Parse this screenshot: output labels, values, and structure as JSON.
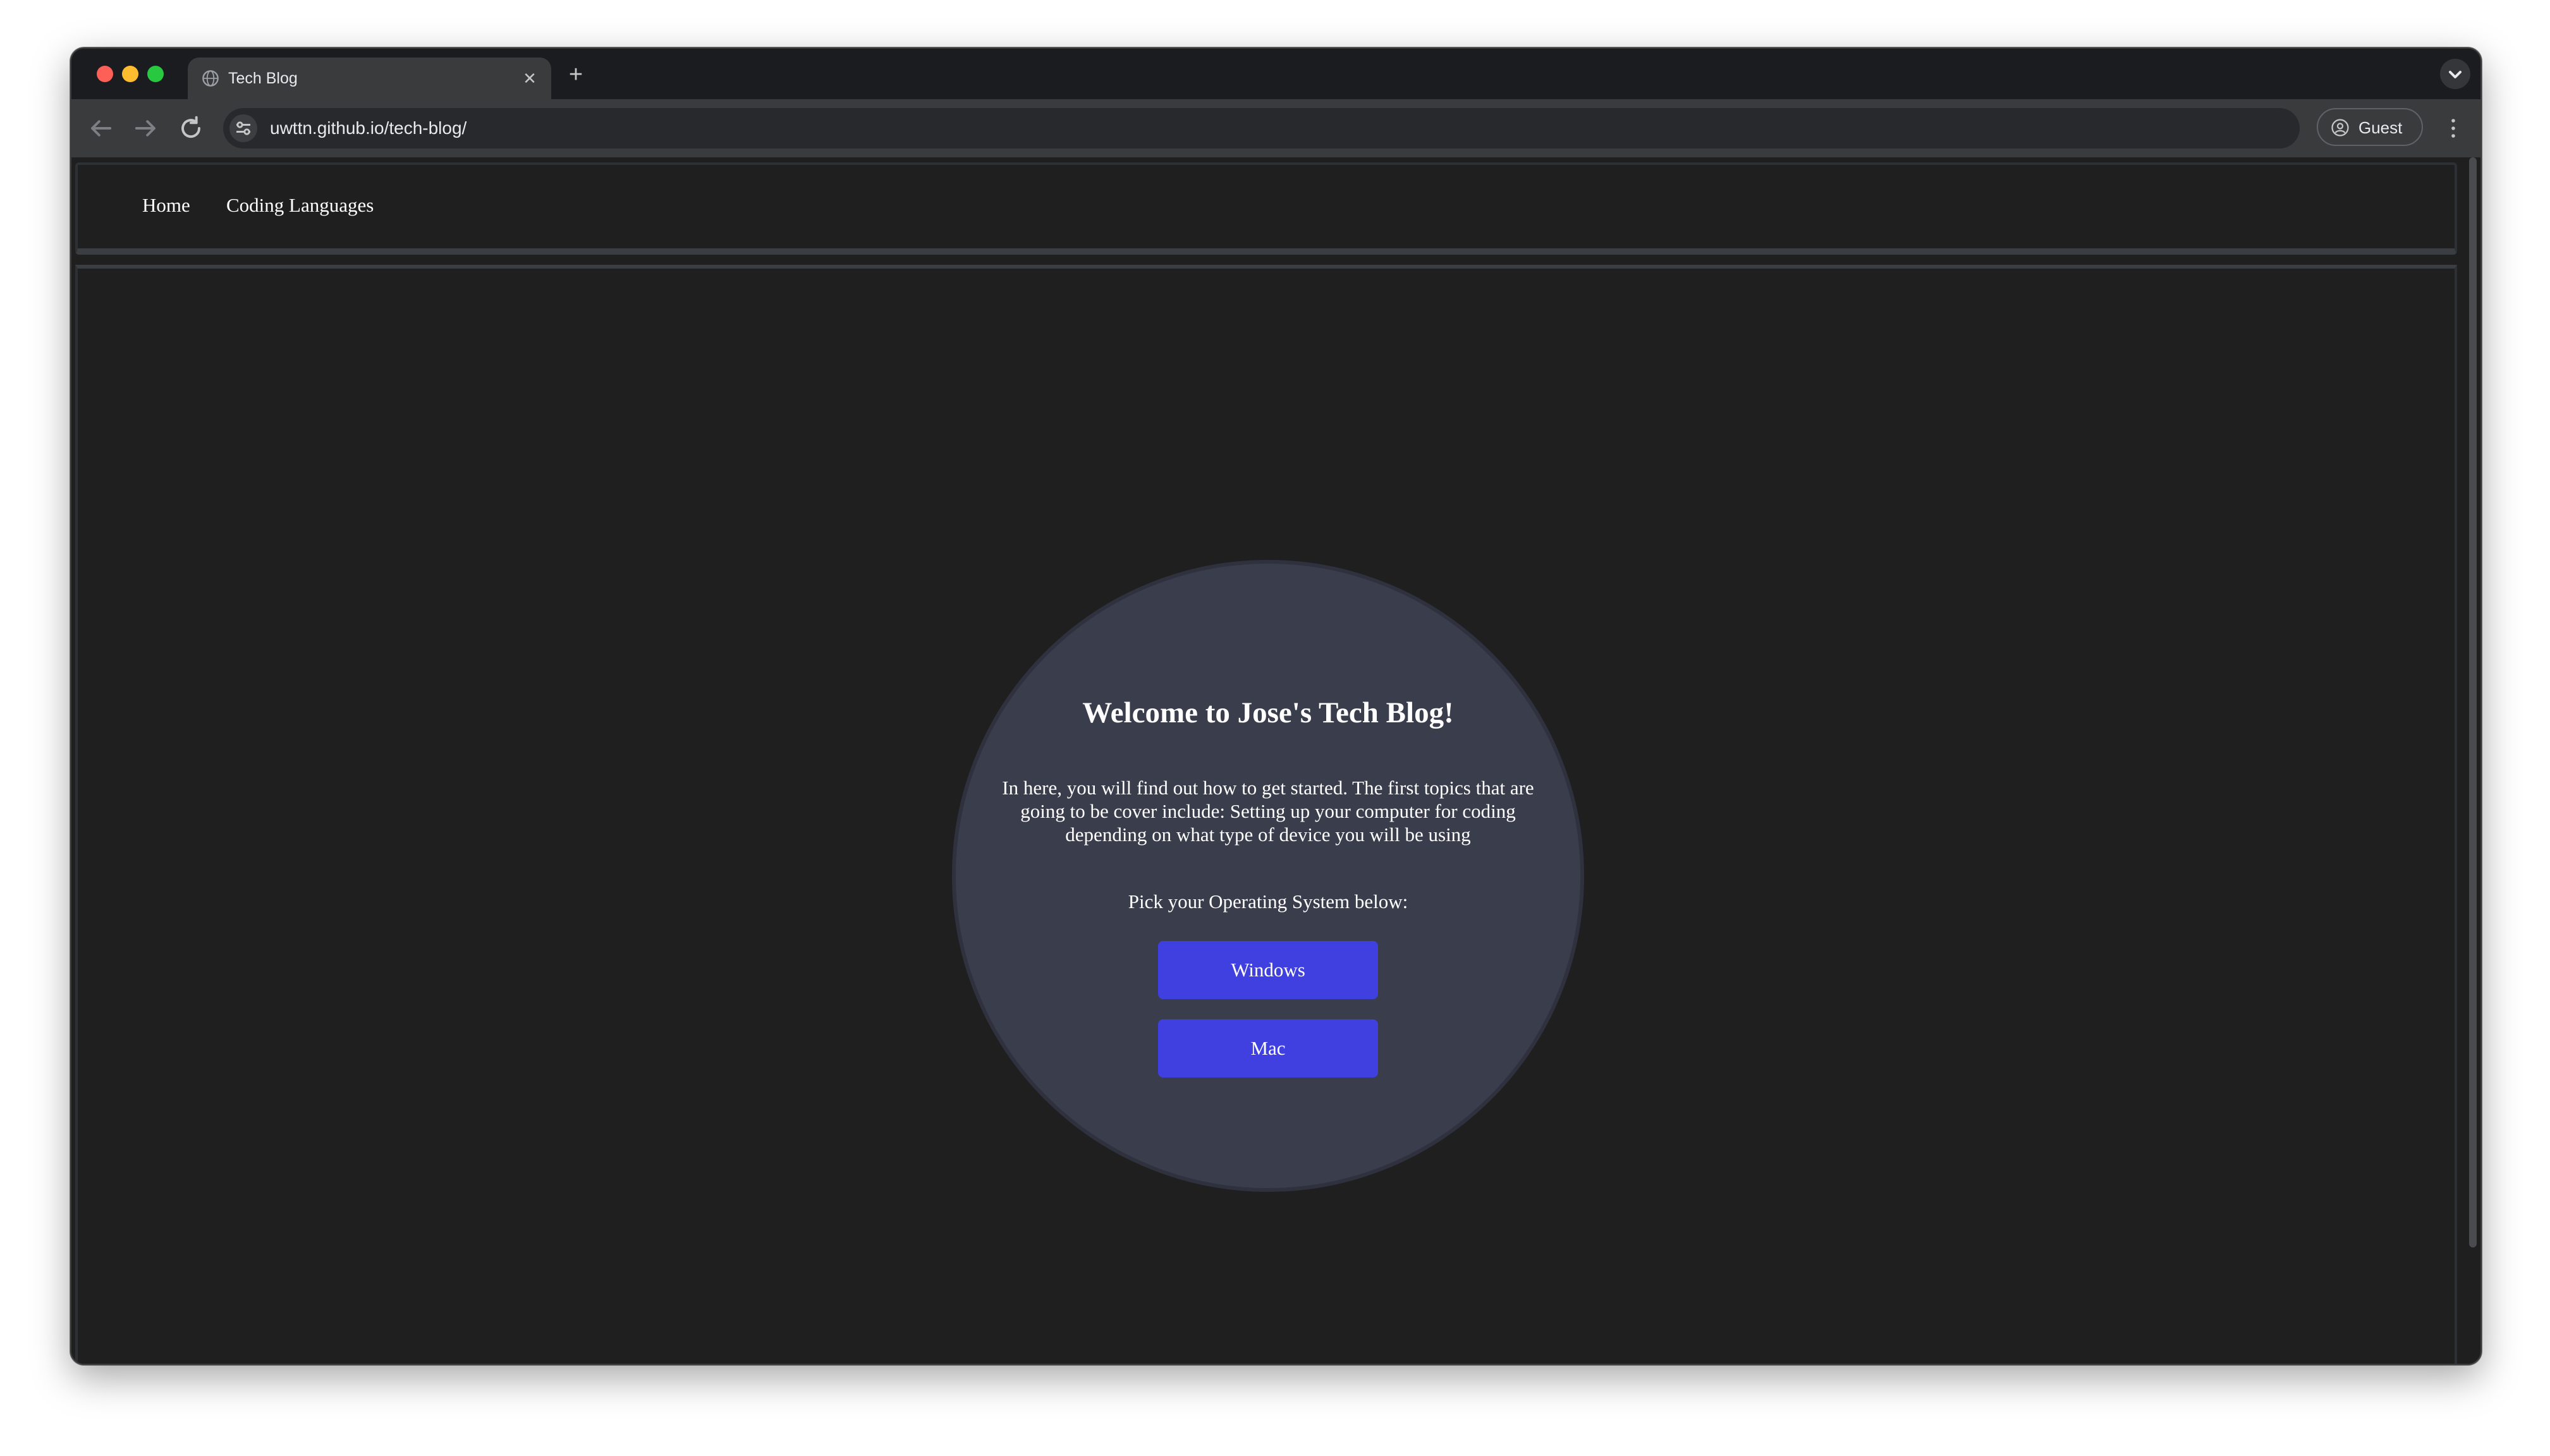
{
  "browser": {
    "tab": {
      "title": "Tech Blog",
      "close_glyph": "✕",
      "icon": "globe-icon"
    },
    "new_tab_glyph": "+",
    "url": "uwttn.github.io/tech-blog/",
    "profile_label": "Guest",
    "colors": {
      "close": "#fe5f57",
      "minimize": "#febc2e",
      "maximize": "#28c840"
    }
  },
  "page": {
    "nav": {
      "items": [
        {
          "label": "Home"
        },
        {
          "label": "Coding Languages"
        }
      ]
    },
    "hero": {
      "title": "Welcome to Jose's Tech Blog!",
      "intro": "In here, you will find out how to get started. The first topics that are going to be cover include: Setting up your computer for coding depending on what type of device you will be using",
      "prompt": "Pick your Operating System below:",
      "buttons": [
        {
          "label": "Windows"
        },
        {
          "label": "Mac"
        }
      ],
      "button_color": "#4040e0",
      "circle_color": "#3a3d4c"
    }
  }
}
